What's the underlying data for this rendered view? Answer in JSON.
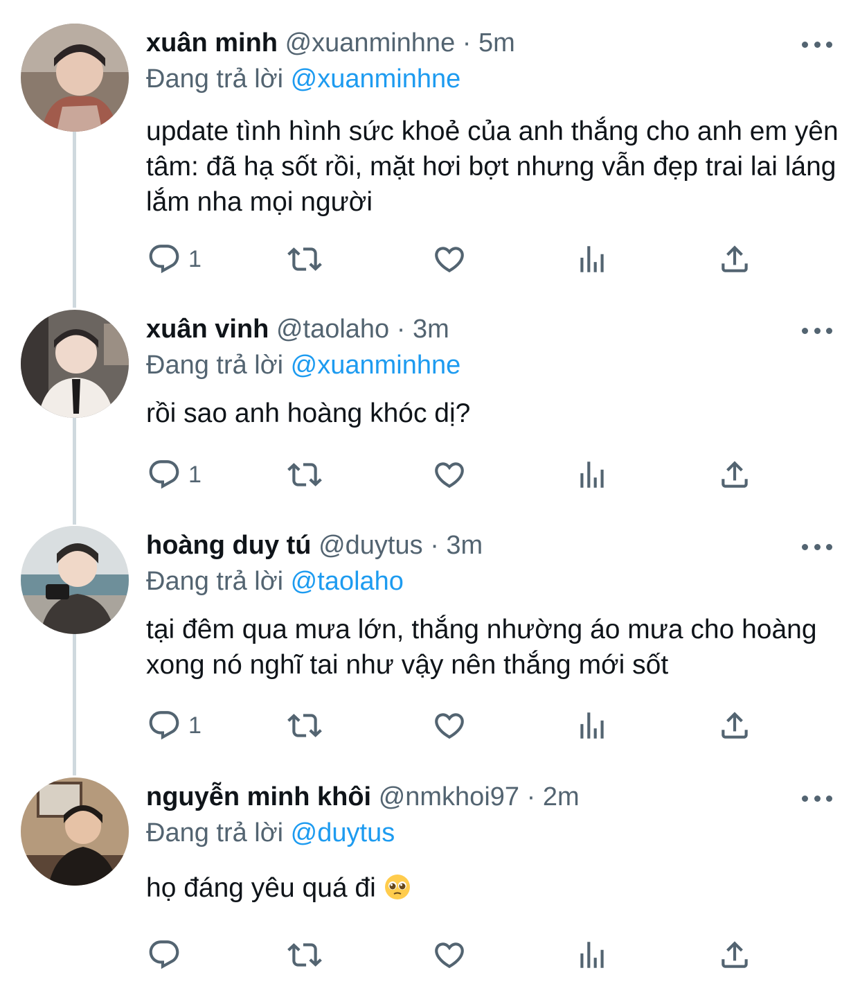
{
  "tweets": [
    {
      "name": "xuân minh",
      "handle": "@xuanminhne",
      "time": "5m",
      "replying_prefix": "Đang trả lời",
      "replying_to": "@xuanminhne",
      "text": "update tình hình sức khoẻ của anh thắng cho anh em yên tâm: đã hạ sốt rồi, mặt hơi bợt nhưng vẫn đẹp trai lai láng lắm nha mọi người",
      "reply_count": "1",
      "avatar_colors": [
        "#8a7a6d",
        "#c9a79a",
        "#4a4141"
      ]
    },
    {
      "name": "xuân vinh",
      "handle": "@taolaho",
      "time": "3m",
      "replying_prefix": "Đang trả lời",
      "replying_to": "@xuanminhne",
      "text": "rồi sao anh hoàng khóc dị?",
      "reply_count": "1",
      "avatar_colors": [
        "#6b6560",
        "#f2ede8",
        "#2b2626"
      ]
    },
    {
      "name": "hoàng duy tú",
      "handle": "@duytus",
      "time": "3m",
      "replying_prefix": "Đang trả lời",
      "replying_to": "@taolaho",
      "text": "tại đêm qua mưa lớn, thắng nhường áo mưa cho hoàng xong nó nghĩ tai như vậy nên thắng mới sốt",
      "reply_count": "1",
      "avatar_colors": [
        "#d9dee0",
        "#6e8f9a",
        "#2e2a28"
      ]
    },
    {
      "name": "nguyễn minh khôi",
      "handle": "@nmkhoi97",
      "time": "2m",
      "replying_prefix": "Đang trả lời",
      "replying_to": "@duytus",
      "text": "họ đáng yêu quá đi",
      "reply_count": "",
      "avatar_colors": [
        "#b59a7c",
        "#5b4536",
        "#1f1a17"
      ]
    }
  ],
  "icons": {
    "reply": "reply-icon",
    "retweet": "retweet-icon",
    "like": "heart-icon",
    "views": "views-icon",
    "share": "share-icon",
    "more": "more-icon",
    "emoji": "pleading-face-emoji"
  },
  "colors": {
    "link": "#1d9bf0",
    "secondary": "#536471",
    "thread_line": "#cfd9de"
  }
}
